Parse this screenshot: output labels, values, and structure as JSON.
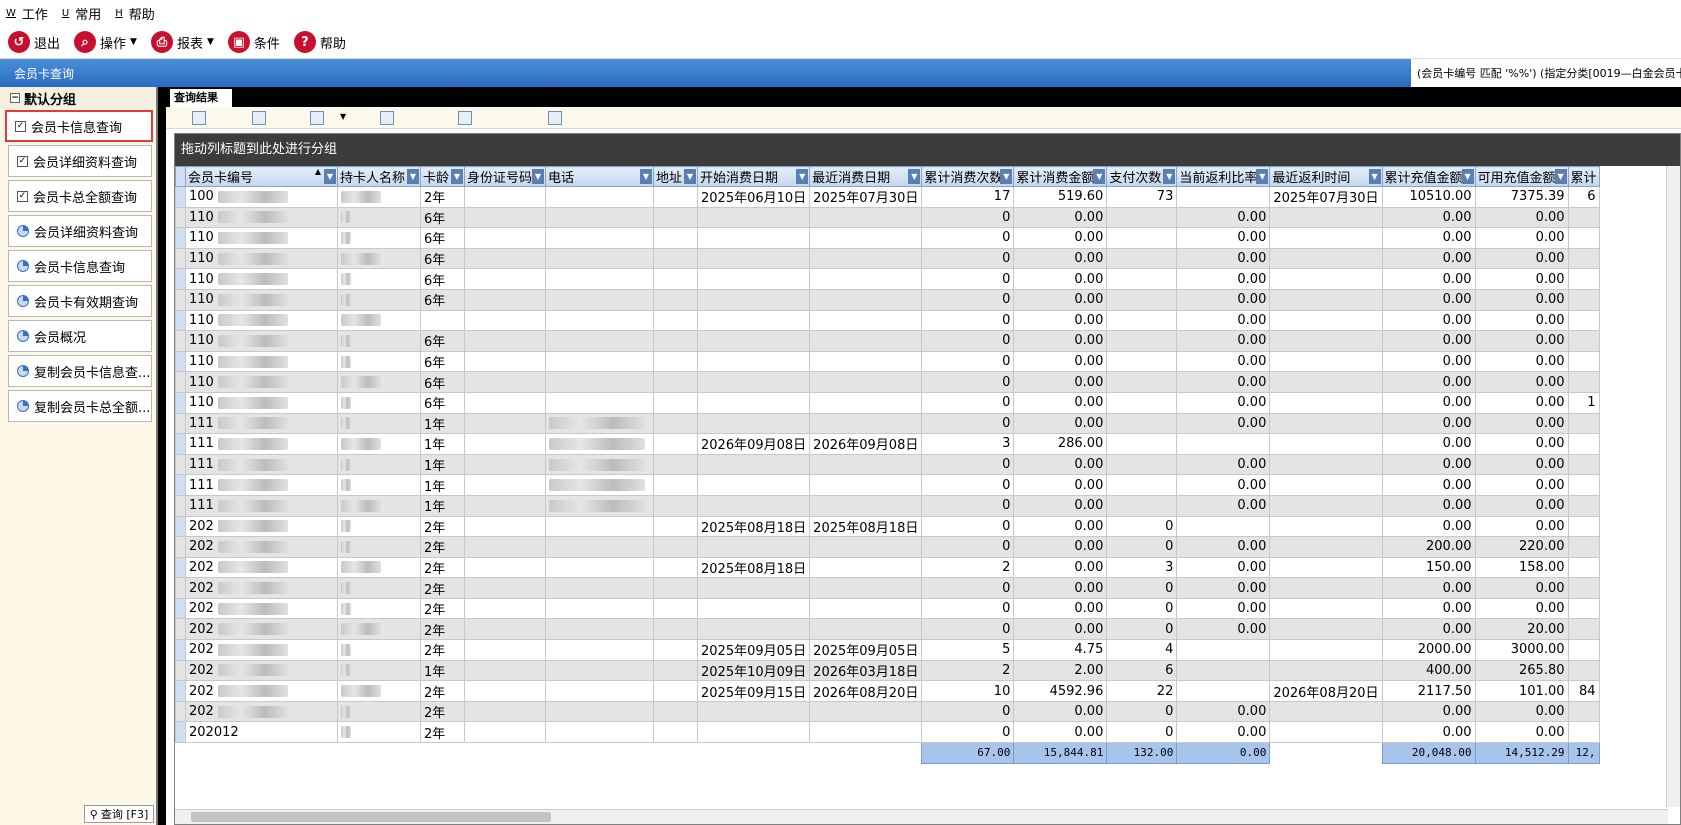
{
  "menu": [
    {
      "key": "W",
      "label": "工作"
    },
    {
      "key": "U",
      "label": "常用"
    },
    {
      "key": "H",
      "label": "帮助"
    }
  ],
  "toolbar": {
    "exit": "退出",
    "operate": "操作",
    "report": "报表",
    "condition": "条件",
    "help": "帮助"
  },
  "window_title": "会员卡查询",
  "condition_text": "(会员卡编号 匹配 '%%') (指定分类[0019—白金会员卡,0",
  "sidebar": {
    "group": "默认分组",
    "items": [
      {
        "label": "会员卡信息查询",
        "icon": "checkbox-icon"
      },
      {
        "label": "会员详细资料查询",
        "icon": "checkbox-icon"
      },
      {
        "label": "会员卡总全额查询",
        "icon": "checkbox-icon"
      },
      {
        "label": "会员详细资料查询",
        "icon": "pie-chart-icon"
      },
      {
        "label": "会员卡信息查询",
        "icon": "pie-chart-icon"
      },
      {
        "label": "会员卡有效期查询",
        "icon": "pie-chart-icon"
      },
      {
        "label": "会员概况",
        "icon": "pie-chart-icon"
      },
      {
        "label": "复制会员卡信息查...",
        "icon": "pie-chart-icon"
      },
      {
        "label": "复制会员卡总全额...",
        "icon": "pie-chart-icon"
      }
    ],
    "query_button": "查询 [F3]"
  },
  "tab": "查询结果",
  "group_hint": "拖动列标题到此处进行分组",
  "columns": [
    "会员卡编号",
    "持卡人名称",
    "卡龄",
    "身份证号码",
    "电话",
    "地址",
    "开始消费日期",
    "最近消费日期",
    "累计消费次数",
    "累计消费金额",
    "支付次数",
    "当前返利比率",
    "最近返利时间",
    "累计充值金额",
    "可用充值金额",
    "累计"
  ],
  "rows": [
    [
      "100",
      "2年",
      "2025年06月10日",
      "2025年07月30日",
      "17",
      "519.60",
      "73",
      "",
      "2025年07月30日",
      "10510.00",
      "7375.39",
      "6"
    ],
    [
      "110",
      "6年",
      "",
      "",
      "0",
      "0.00",
      "",
      "0.00",
      "",
      "0.00",
      "0.00",
      ""
    ],
    [
      "110",
      "6年",
      "",
      "",
      "0",
      "0.00",
      "",
      "0.00",
      "",
      "0.00",
      "0.00",
      ""
    ],
    [
      "110",
      "6年",
      "",
      "",
      "0",
      "0.00",
      "",
      "0.00",
      "",
      "0.00",
      "0.00",
      ""
    ],
    [
      "110",
      "6年",
      "",
      "",
      "0",
      "0.00",
      "",
      "0.00",
      "",
      "0.00",
      "0.00",
      ""
    ],
    [
      "110",
      "6年",
      "",
      "",
      "0",
      "0.00",
      "",
      "0.00",
      "",
      "0.00",
      "0.00",
      ""
    ],
    [
      "110",
      "",
      "",
      "",
      "0",
      "0.00",
      "",
      "0.00",
      "",
      "0.00",
      "0.00",
      ""
    ],
    [
      "110",
      "6年",
      "",
      "",
      "0",
      "0.00",
      "",
      "0.00",
      "",
      "0.00",
      "0.00",
      ""
    ],
    [
      "110",
      "6年",
      "",
      "",
      "0",
      "0.00",
      "",
      "0.00",
      "",
      "0.00",
      "0.00",
      ""
    ],
    [
      "110",
      "6年",
      "",
      "",
      "0",
      "0.00",
      "",
      "0.00",
      "",
      "0.00",
      "0.00",
      ""
    ],
    [
      "110",
      "6年",
      "",
      "",
      "0",
      "0.00",
      "",
      "0.00",
      "",
      "0.00",
      "0.00",
      "1"
    ],
    [
      "111",
      "1年",
      "",
      "",
      "0",
      "0.00",
      "",
      "0.00",
      "",
      "0.00",
      "0.00",
      ""
    ],
    [
      "111",
      "1年",
      "2026年09月08日",
      "2026年09月08日",
      "3",
      "286.00",
      "",
      "",
      "",
      "0.00",
      "0.00",
      ""
    ],
    [
      "111",
      "1年",
      "",
      "",
      "0",
      "0.00",
      "",
      "0.00",
      "",
      "0.00",
      "0.00",
      ""
    ],
    [
      "111",
      "1年",
      "",
      "",
      "0",
      "0.00",
      "",
      "0.00",
      "",
      "0.00",
      "0.00",
      ""
    ],
    [
      "111",
      "1年",
      "",
      "",
      "0",
      "0.00",
      "",
      "0.00",
      "",
      "0.00",
      "0.00",
      ""
    ],
    [
      "202",
      "2年",
      "2025年08月18日",
      "2025年08月18日",
      "0",
      "0.00",
      "0",
      "",
      "",
      "0.00",
      "0.00",
      ""
    ],
    [
      "202",
      "2年",
      "",
      "",
      "0",
      "0.00",
      "0",
      "0.00",
      "",
      "200.00",
      "220.00",
      ""
    ],
    [
      "202",
      "2年",
      "2025年08月18日",
      "",
      "2",
      "0.00",
      "3",
      "0.00",
      "",
      "150.00",
      "158.00",
      ""
    ],
    [
      "202",
      "2年",
      "",
      "",
      "0",
      "0.00",
      "0",
      "0.00",
      "",
      "0.00",
      "0.00",
      ""
    ],
    [
      "202",
      "2年",
      "",
      "",
      "0",
      "0.00",
      "0",
      "0.00",
      "",
      "0.00",
      "0.00",
      ""
    ],
    [
      "202",
      "2年",
      "",
      "",
      "0",
      "0.00",
      "0",
      "0.00",
      "",
      "0.00",
      "20.00",
      ""
    ],
    [
      "202",
      "2年",
      "2025年09月05日",
      "2025年09月05日",
      "5",
      "4.75",
      "4",
      "",
      "",
      "2000.00",
      "3000.00",
      ""
    ],
    [
      "202",
      "1年",
      "2025年10月09日",
      "2026年03月18日",
      "2",
      "2.00",
      "6",
      "",
      "",
      "400.00",
      "265.80",
      ""
    ],
    [
      "202",
      "2年",
      "2025年09月15日",
      "2026年08月20日",
      "10",
      "4592.96",
      "22",
      "",
      "2026年08月20日",
      "2117.50",
      "101.00",
      "84"
    ],
    [
      "202",
      "2年",
      "",
      "",
      "0",
      "0.00",
      "0",
      "0.00",
      "",
      "0.00",
      "0.00",
      ""
    ],
    [
      "202012",
      "2年",
      "",
      "",
      "0",
      "0.00",
      "0",
      "0.00",
      "",
      "0.00",
      "0.00",
      ""
    ]
  ],
  "totals": {
    "count": "67.00",
    "amount": "15,844.81",
    "pay_count": "132.00",
    "rebate": "0.00",
    "recharge": "20,048.00",
    "available": "14,512.29",
    "last": "12,"
  }
}
